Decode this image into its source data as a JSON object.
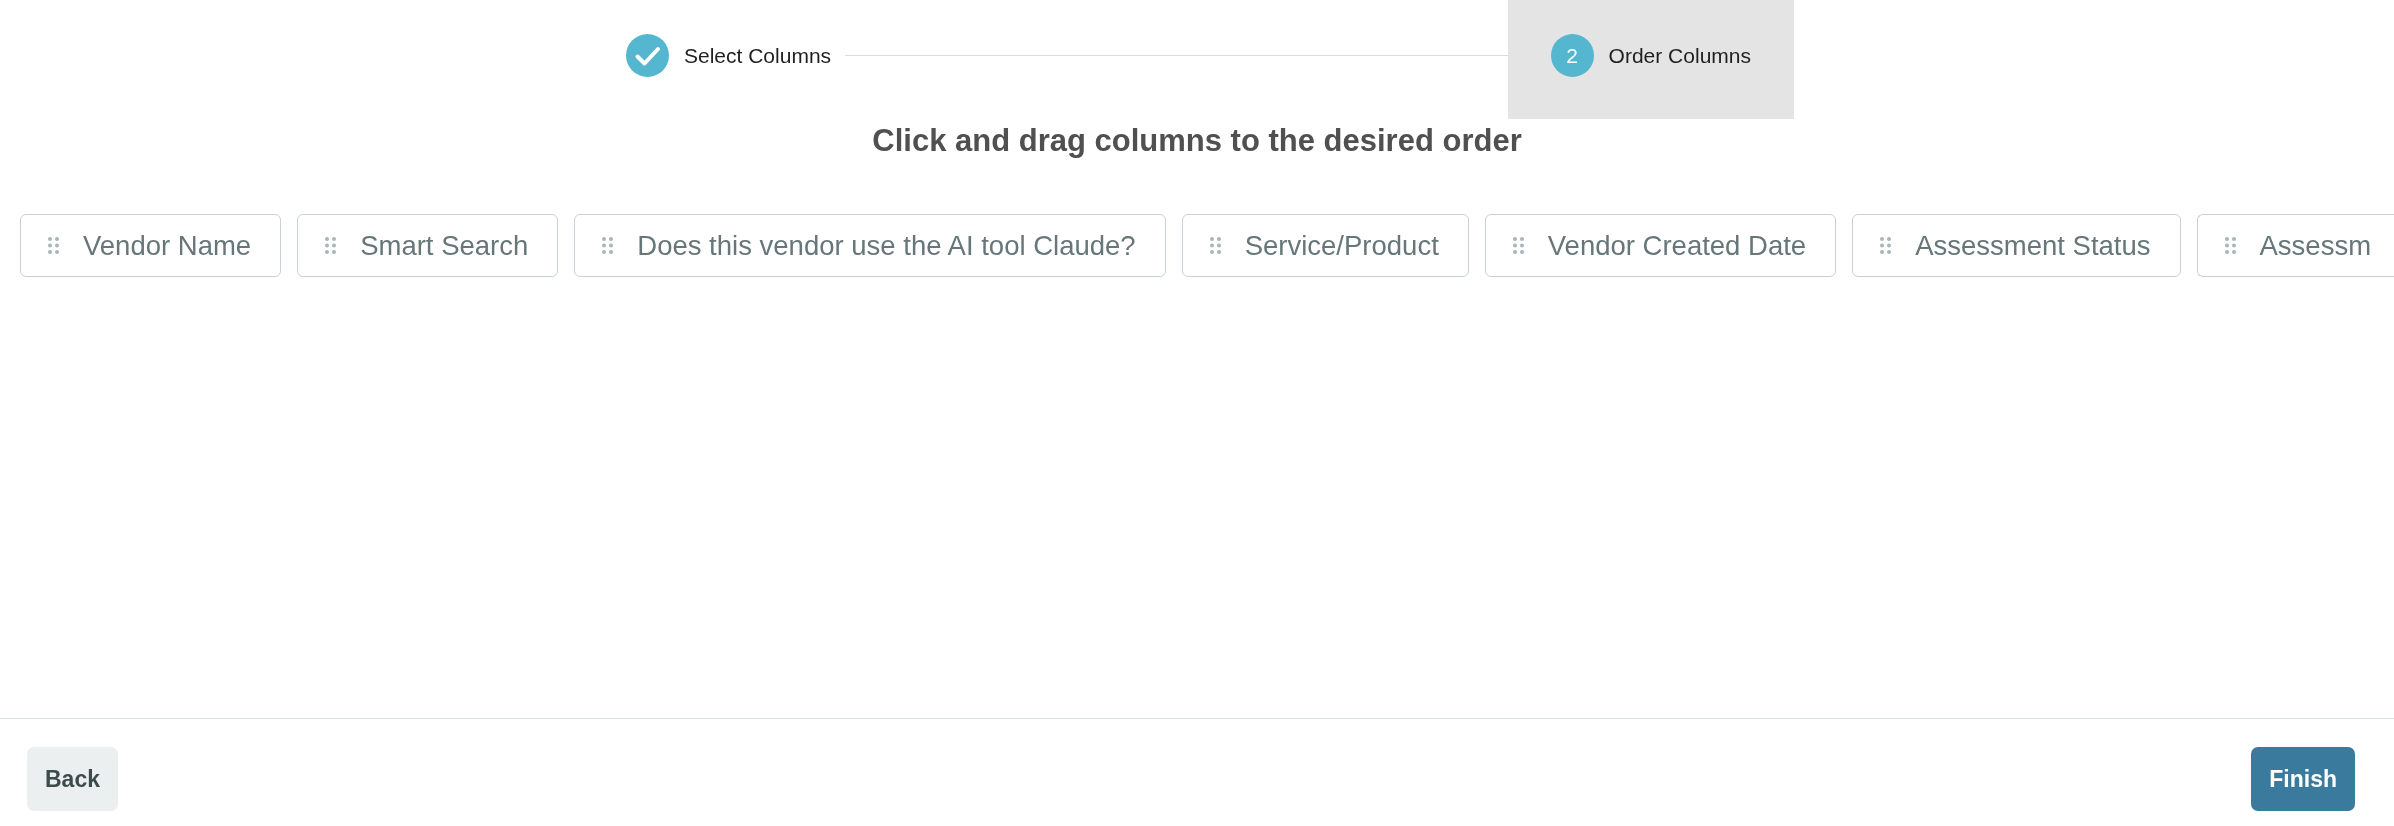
{
  "stepper": {
    "steps": [
      {
        "label": "Select Columns",
        "completed": true,
        "selected": false
      },
      {
        "number": "2",
        "label": "Order Columns",
        "completed": false,
        "selected": true
      }
    ]
  },
  "instruction": "Click and drag columns to the desired order",
  "columns": [
    "Vendor Name",
    "Smart Search",
    "Does this vendor use the AI tool Claude?",
    "Service/Product",
    "Vendor Created Date",
    "Assessment Status",
    "Assessm"
  ],
  "footer": {
    "buttons": [
      {
        "label": "Back",
        "kind": "secondary"
      },
      {
        "label": "Finish",
        "kind": "primary"
      }
    ]
  }
}
